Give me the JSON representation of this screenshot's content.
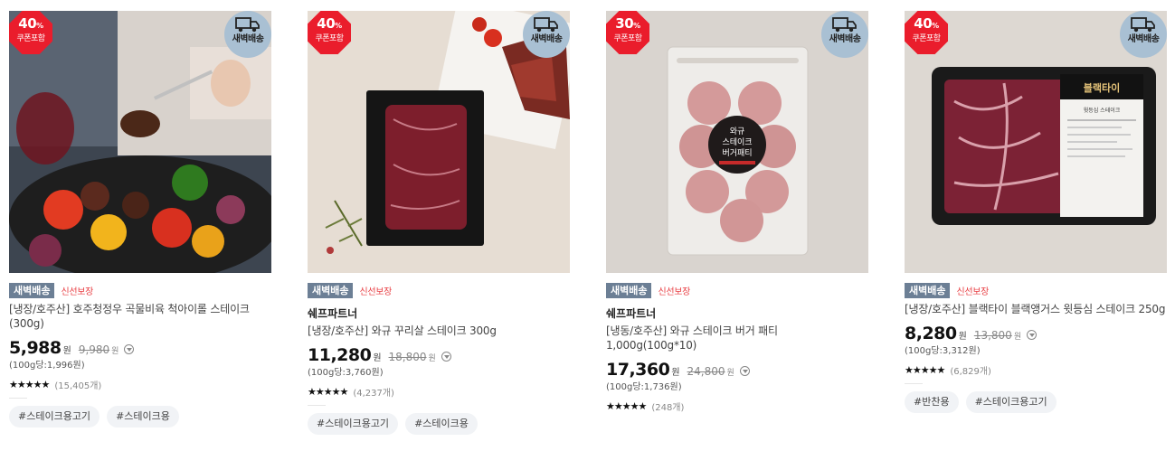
{
  "products": [
    {
      "coupon": {
        "percent": "40",
        "unit": "%",
        "label": "쿠폰포함"
      },
      "delivery_badge": "새벽배송",
      "tag_dawn": "새벽배송",
      "tag_fresh": "신선보장",
      "brand": "",
      "title": "[냉장/호주산] 호주청정우 곡물비육 척아이롤 스테이크 (300g)",
      "price": "5,988",
      "won": "원",
      "original_price": "9,980",
      "original_won": "원",
      "unit_price": "(100g당:1,996원)",
      "stars": "★★★★★",
      "rating": 4.8,
      "reviews": "(15,405개)",
      "hashtags": [
        "#스테이크용고기",
        "#스테이크용"
      ]
    },
    {
      "coupon": {
        "percent": "40",
        "unit": "%",
        "label": "쿠폰포함"
      },
      "delivery_badge": "새벽배송",
      "tag_dawn": "새벽배송",
      "tag_fresh": "신선보장",
      "brand": "쉐프파트너",
      "title": "[냉장/호주산] 와규 꾸리살 스테이크 300g",
      "price": "11,280",
      "won": "원",
      "original_price": "18,800",
      "original_won": "원",
      "unit_price": "(100g당:3,760원)",
      "stars": "★★★★★",
      "rating": 4.8,
      "reviews": "(4,237개)",
      "hashtags": [
        "#스테이크용고기",
        "#스테이크용"
      ]
    },
    {
      "coupon": {
        "percent": "30",
        "unit": "%",
        "label": "쿠폰포함"
      },
      "delivery_badge": "새벽배송",
      "tag_dawn": "새벽배송",
      "tag_fresh": "신선보장",
      "brand": "쉐프파트너",
      "title": "[냉동/호주산] 와규 스테이크 버거 패티 1,000g(100g*10)",
      "price": "17,360",
      "won": "원",
      "original_price": "24,800",
      "original_won": "원",
      "unit_price": "(100g당:1,736원)",
      "stars": "★★★★★",
      "rating": 4.8,
      "reviews": "(248개)",
      "hashtags": [],
      "package_label": [
        "와규",
        "스테이크",
        "버거패티"
      ]
    },
    {
      "coupon": {
        "percent": "40",
        "unit": "%",
        "label": "쿠폰포함"
      },
      "delivery_badge": "새벽배송",
      "tag_dawn": "새벽배송",
      "tag_fresh": "신선보장",
      "brand": "",
      "title": "[냉장/호주산] 블랙타이 블랙앵거스 윗등심 스테이크 250g",
      "price": "8,280",
      "won": "원",
      "original_price": "13,800",
      "original_won": "원",
      "unit_price": "(100g당:3,312원)",
      "stars": "★★★★★",
      "rating": 4.8,
      "reviews": "(6,829개)",
      "hashtags": [
        "#반찬용",
        "#스테이크용고기"
      ],
      "package_label": [
        "블랙타이",
        "윗등심 스테이크"
      ]
    }
  ],
  "colors": {
    "coupon_red": "#ea1d2c",
    "dawn_tag": "#6c7f95",
    "fresh_red": "#e83e43",
    "dawn_circle": "#a9c0d3"
  },
  "icons": [
    "truck-icon",
    "info-icon",
    "star-icon"
  ]
}
